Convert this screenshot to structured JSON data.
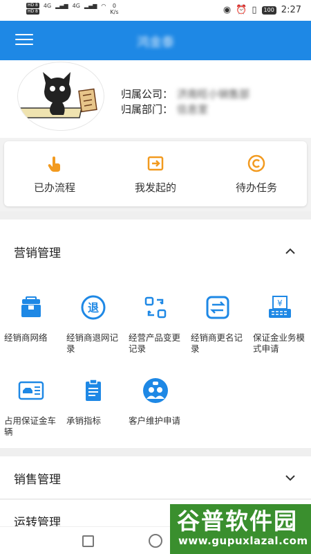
{
  "status_bar": {
    "sim1": "HD 8",
    "sim2": "HD 8",
    "net": "4G",
    "speed_value": "0",
    "speed_unit": "K/s",
    "battery": "100",
    "time": "2:27"
  },
  "header": {
    "title": "鸿金泰"
  },
  "profile": {
    "company_label": "归属公司：",
    "company_value": "济南旺小销售部",
    "dept_label": "归属部门：",
    "dept_value": "信息室"
  },
  "quick_actions": [
    {
      "label": "已办流程",
      "icon": "hand-tap-icon"
    },
    {
      "label": "我发起的",
      "icon": "export-box-icon"
    },
    {
      "label": "待办任务",
      "icon": "copyright-circle-icon"
    }
  ],
  "sections": {
    "marketing": {
      "title": "营销管理",
      "expanded": true,
      "items": [
        {
          "label": "经销商网络",
          "icon": "briefcase-icon"
        },
        {
          "label": "经销商退网记录",
          "icon": "tui-circle-icon"
        },
        {
          "label": "经营产品变更记录",
          "icon": "swap-frame-icon"
        },
        {
          "label": "经销商更名记录",
          "icon": "exchange-square-icon"
        },
        {
          "label": "保证金业务模式申请",
          "icon": "yen-register-icon"
        },
        {
          "label": "占用保证金车辆",
          "icon": "car-card-icon"
        },
        {
          "label": "承销指标",
          "icon": "clipboard-icon"
        },
        {
          "label": "客户维护申请",
          "icon": "customer-chat-icon"
        }
      ]
    },
    "sales": {
      "title": "销售管理",
      "expanded": false
    },
    "transport": {
      "title": "运转管理"
    }
  },
  "watermark": {
    "line1": "谷普软件园",
    "line2": "www.gupuxlazal.com"
  },
  "colors": {
    "primary": "#1e88e5",
    "icon_blue": "#1e88e5",
    "quick_orange": "#f29a1f"
  }
}
